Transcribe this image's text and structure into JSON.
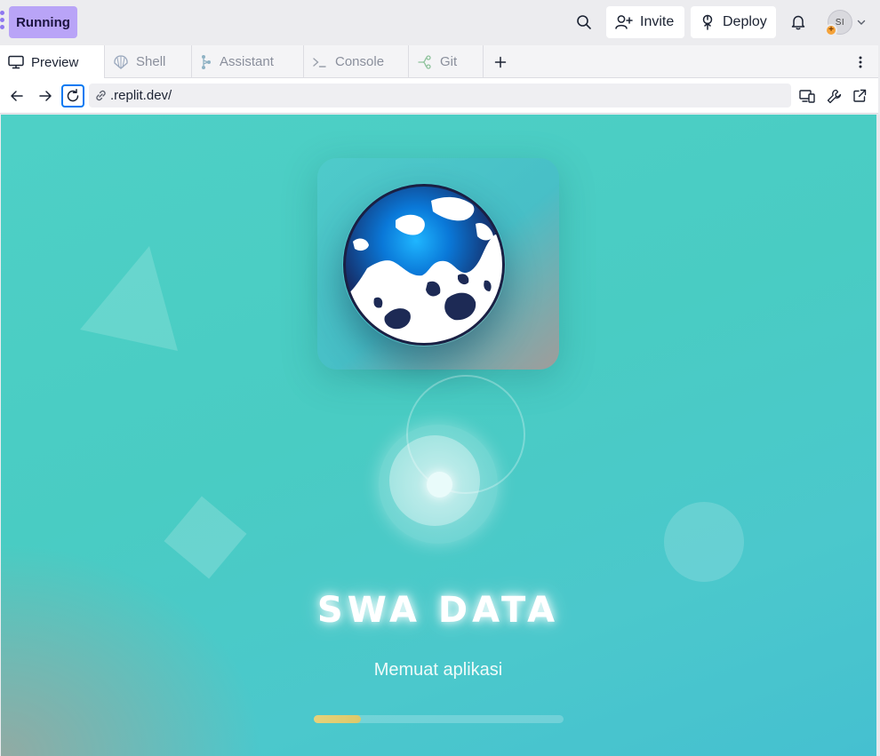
{
  "topbar": {
    "run_label": "Running",
    "invite_label": "Invite",
    "deploy_label": "Deploy",
    "avatar_initials": "SI",
    "avatar_badge": "+"
  },
  "tabs": [
    {
      "label": "Preview",
      "icon": "monitor-icon",
      "active": true
    },
    {
      "label": "Shell",
      "icon": "shell-icon",
      "active": false
    },
    {
      "label": "Assistant",
      "icon": "assistant-icon",
      "active": false
    },
    {
      "label": "Console",
      "icon": "console-icon",
      "active": false
    },
    {
      "label": "Git",
      "icon": "git-icon",
      "active": false
    }
  ],
  "addressbar": {
    "url": ".replit.dev/"
  },
  "app": {
    "title": "SWA DATA",
    "loading_text": "Memuat aplikasi",
    "progress_fraction": 0.19
  },
  "colors": {
    "run_button": "#b9a4f7",
    "accent_focus": "#0079f2",
    "preview_background": "#4ed0c6",
    "progress_fill": "#e7d27a"
  }
}
